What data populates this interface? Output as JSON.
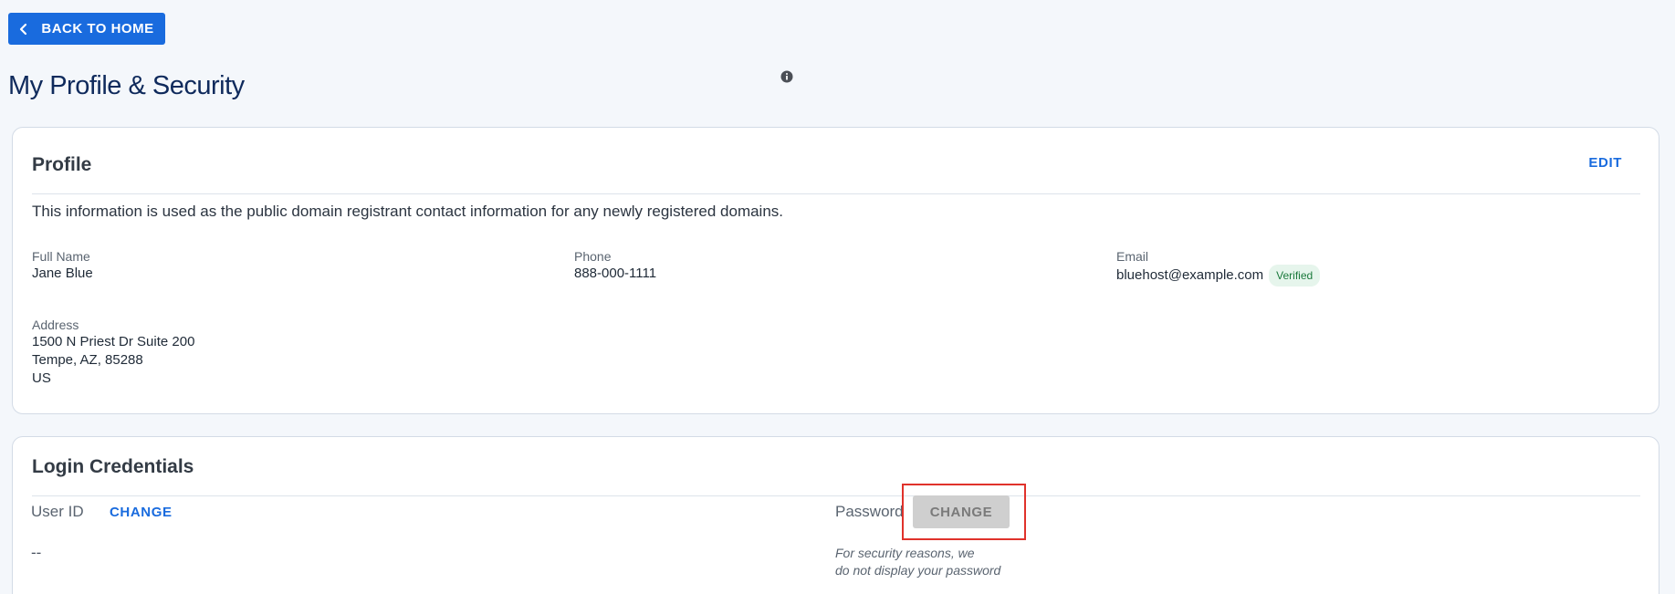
{
  "header": {
    "back_label": "BACK TO HOME",
    "page_title": "My Profile & Security"
  },
  "profile": {
    "title": "Profile",
    "edit_label": "EDIT",
    "description": "This information is used as the public domain registrant contact information for any newly registered domains.",
    "full_name_label": "Full Name",
    "full_name": "Jane Blue",
    "phone_label": "Phone",
    "phone": "888-000-1111",
    "email_label": "Email",
    "email": "bluehost@example.com",
    "email_status": "Verified",
    "address_label": "Address",
    "address_line1": "1500 N Priest Dr Suite 200",
    "address_line2": "Tempe, AZ, 85288",
    "address_line3": "US"
  },
  "login": {
    "title": "Login Credentials",
    "user_id_label": "User ID",
    "user_id_change": "CHANGE",
    "user_id_value": "--",
    "password_label": "Password",
    "password_change": "CHANGE",
    "password_note_line1": "For security reasons, we",
    "password_note_line2": "do not display your password"
  },
  "colors": {
    "primary": "#196bde",
    "title": "#0f2a5c",
    "verified_bg": "#e6f5ec",
    "verified_text": "#1b7a3c",
    "highlight": "#e0322b"
  },
  "icons": {
    "back": "chevron-left-icon",
    "info": "info-icon"
  }
}
